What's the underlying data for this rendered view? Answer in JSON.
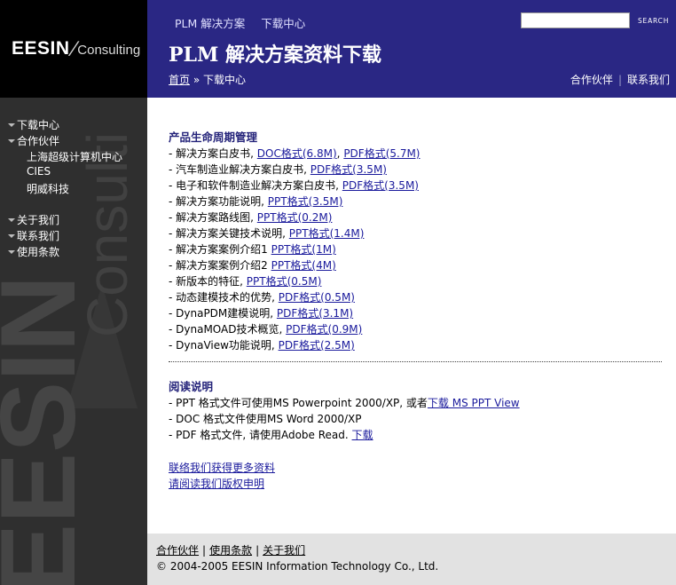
{
  "logo": {
    "brand": "EESIN",
    "sub": "Consulting"
  },
  "sidebar": {
    "watermark_top": "Consulti",
    "watermark_bottom": "EESIN",
    "items": [
      {
        "label": "下载中心"
      },
      {
        "label": "合作伙伴"
      },
      {
        "label": "关于我们"
      },
      {
        "label": "联系我们"
      },
      {
        "label": "使用条款"
      }
    ],
    "partners": [
      {
        "label": "上海超级计算机中心"
      },
      {
        "label": "CIES"
      },
      {
        "label": "明威科技"
      }
    ]
  },
  "header": {
    "topnav": {
      "plm": "PLM 解决方案",
      "download": "下载中心"
    },
    "search_label": "SEARCH",
    "title": "PLM 解决方案资料下载",
    "breadcrumb": {
      "home": "首页",
      "sep": " » ",
      "current": "下载中心"
    },
    "links": {
      "partners": "合作伙伴",
      "sep": "|",
      "contact": "联系我们"
    }
  },
  "main": {
    "section1_title": "产品生命周期管理",
    "items": [
      {
        "text": "- 解决方案白皮书,",
        "links": [
          {
            "label": "DOC格式(6.8M)"
          },
          {
            "label": "PDF格式(5.7M)"
          }
        ]
      },
      {
        "text": "- 汽车制造业解决方案白皮书,",
        "links": [
          {
            "label": "PDF格式(3.5M)"
          }
        ]
      },
      {
        "text": "- 电子和软件制造业解决方案白皮书,",
        "links": [
          {
            "label": "PDF格式(3.5M)"
          }
        ]
      },
      {
        "text": "- 解决方案功能说明,",
        "links": [
          {
            "label": "PPT格式(3.5M)"
          }
        ]
      },
      {
        "text": "- 解决方案路线图,",
        "links": [
          {
            "label": "PPT格式(0.2M)"
          }
        ]
      },
      {
        "text": "- 解决方案关键技术说明,",
        "links": [
          {
            "label": "PPT格式(1.4M)"
          }
        ]
      },
      {
        "text": "- 解决方案案例介绍1",
        "links": [
          {
            "label": "PPT格式(1M)"
          }
        ]
      },
      {
        "text": "- 解决方案案例介绍2",
        "links": [
          {
            "label": "PPT格式(4M)"
          }
        ]
      },
      {
        "text": "- 新版本的特征,",
        "links": [
          {
            "label": "PPT格式(0.5M)"
          }
        ]
      },
      {
        "text": "- 动态建模技术的优势,",
        "links": [
          {
            "label": "PDF格式(0.5M)"
          }
        ]
      },
      {
        "text": "- DynaPDM建模说明,",
        "links": [
          {
            "label": "PDF格式(3.1M)"
          }
        ]
      },
      {
        "text": "- DynaMOAD技术概览,",
        "links": [
          {
            "label": "PDF格式(0.9M)"
          }
        ]
      },
      {
        "text": "- DynaView功能说明,",
        "links": [
          {
            "label": "PDF格式(2.5M)"
          }
        ]
      }
    ],
    "section2_title": "阅读说明",
    "read": [
      {
        "text": "- PPT 格式文件可使用MS Powerpoint 2000/XP, 或者",
        "link": "下载 MS PPT View"
      },
      {
        "text": "- DOC 格式文件使用MS Word 2000/XP",
        "link": ""
      },
      {
        "text": "- PDF 格式文件, 请使用Adobe Read.",
        "link": "下载"
      }
    ],
    "extra_links": {
      "contact_more": "联络我们获得更多资料",
      "copyright": "请阅读我们版权申明"
    }
  },
  "footer": {
    "links": {
      "partners": "合作伙伴",
      "terms": "使用条款",
      "about": "关于我们",
      "sep": "|"
    },
    "copyright": "© 2004-2005 EESIN Information Technology Co., Ltd."
  },
  "colors": {
    "header_bg": "#2a2784",
    "sidebar_bg": "#2f2f2f",
    "link": "#1a1a9c",
    "footer_bg": "#e2e2e2"
  }
}
